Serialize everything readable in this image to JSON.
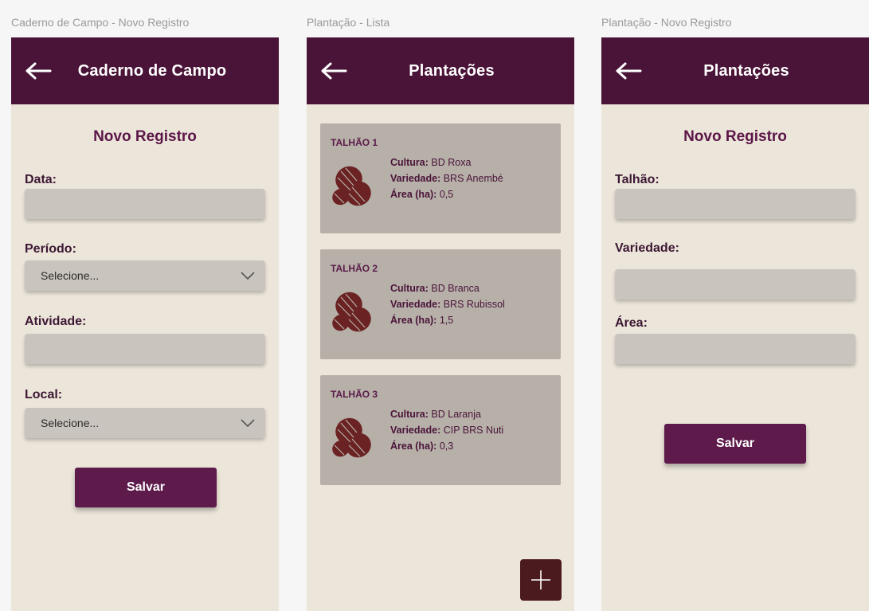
{
  "frames": {
    "caderno": "Caderno de Campo - Novo Registro",
    "lista": "Plantação - Lista",
    "novo": "Plantação - Novo Registro"
  },
  "screen1": {
    "title": "Caderno de Campo",
    "section": "Novo Registro",
    "fields": {
      "data": "Data:",
      "periodo": "Período:",
      "atividade": "Atividade:",
      "local": "Local:"
    },
    "select_placeholder_periodo": "Selecione...",
    "select_placeholder_local": "Selecione...",
    "save": "Salvar"
  },
  "screen2": {
    "title": "Plantações",
    "labels": {
      "cultura": "Cultura:",
      "variedade": "Variedade:",
      "area": "Área (ha):"
    },
    "cards": [
      {
        "talhao": "TALHÃO 1",
        "cultura": "BD Roxa",
        "variedade": "BRS Anembé",
        "area": "0,5"
      },
      {
        "talhao": "TALHÃO 2",
        "cultura": "BD Branca",
        "variedade": "BRS Rubissol",
        "area": "1,5"
      },
      {
        "talhao": "TALHÃO 3",
        "cultura": "BD Laranja",
        "variedade": "CIP BRS Nuti",
        "area": "0,3"
      }
    ]
  },
  "screen3": {
    "title": "Plantações",
    "section": "Novo Registro",
    "fields": {
      "talhao": "Talhão:",
      "variedade": "Variedade:",
      "area": "Área:"
    },
    "save": "Salvar"
  },
  "colors": {
    "appbar": "#4a1338",
    "accent": "#5d1a4a",
    "background": "#ece5da",
    "card": "#b6b0a9",
    "fab": "#4a1a1e",
    "seed": "#6b2222"
  },
  "icons": [
    "arrow-left-icon",
    "chevron-down-icon",
    "seed-icon",
    "plus-icon"
  ]
}
